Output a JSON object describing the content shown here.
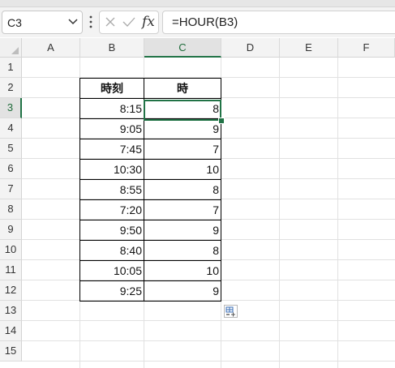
{
  "namebox": {
    "value": "C3"
  },
  "formula_bar": {
    "value": "=HOUR(B3)",
    "fx_label": "fx"
  },
  "columns": [
    "A",
    "B",
    "C",
    "D",
    "E",
    "F"
  ],
  "rows": [
    "1",
    "2",
    "3",
    "4",
    "5",
    "6",
    "7",
    "8",
    "9",
    "10",
    "11",
    "12",
    "13",
    "14",
    "15"
  ],
  "table": {
    "headers": [
      "時刻",
      "時"
    ],
    "rows": [
      [
        "8:15",
        "8"
      ],
      [
        "9:05",
        "9"
      ],
      [
        "7:45",
        "7"
      ],
      [
        "10:30",
        "10"
      ],
      [
        "8:55",
        "8"
      ],
      [
        "7:20",
        "7"
      ],
      [
        "9:50",
        "9"
      ],
      [
        "8:40",
        "8"
      ],
      [
        "10:05",
        "10"
      ],
      [
        "9:25",
        "9"
      ]
    ]
  },
  "selection": {
    "active_column": "C",
    "active_row": "3"
  },
  "colors": {
    "accent": "#217346",
    "grid": "#e1e1e1",
    "header_bg": "#f3f3f3"
  },
  "icons": [
    "chevron-down-icon",
    "vertical-dots-icon",
    "cancel-x-icon",
    "check-icon",
    "fx-icon",
    "quick-analysis-icon"
  ]
}
